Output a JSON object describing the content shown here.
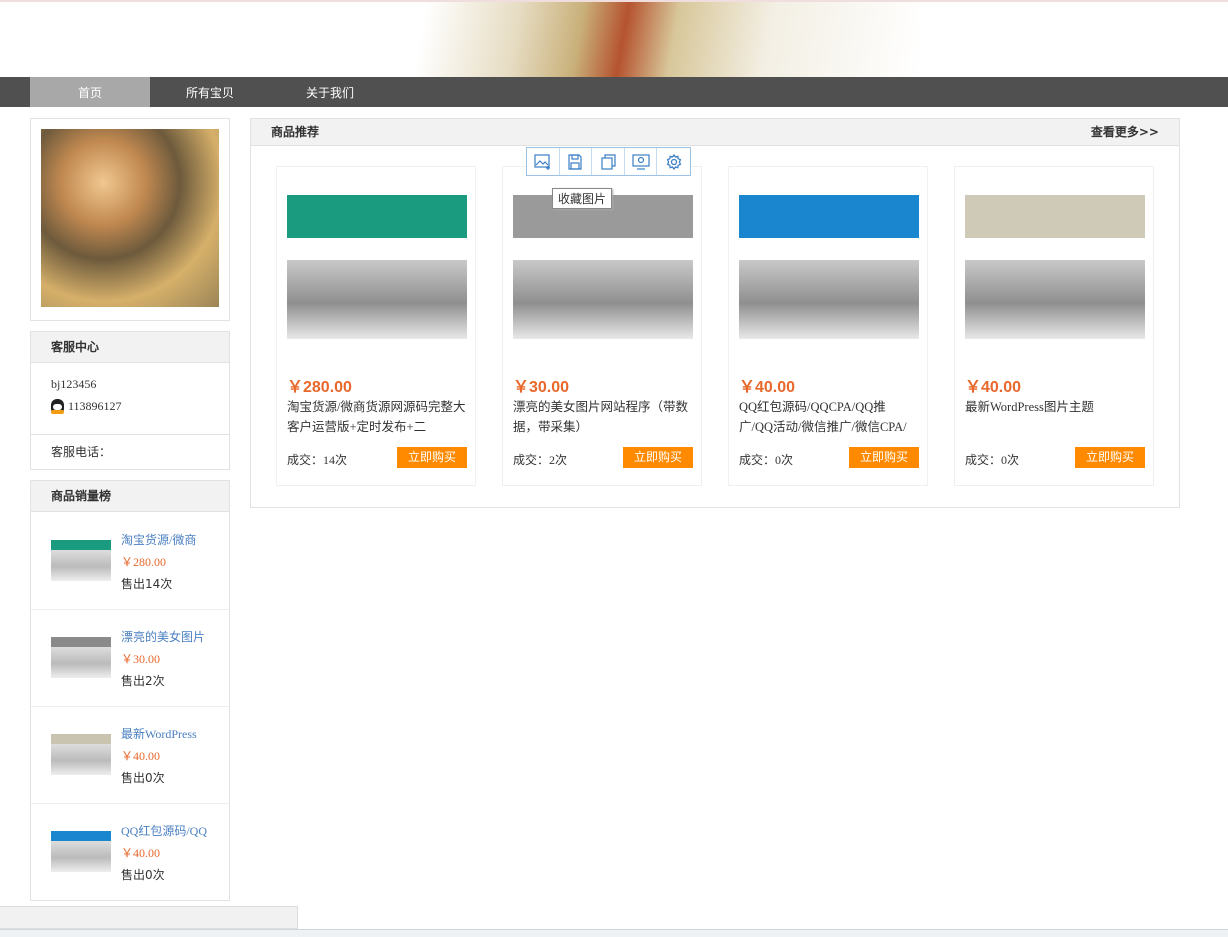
{
  "nav": {
    "items": [
      {
        "label": "首页",
        "active": true
      },
      {
        "label": "所有宝贝"
      },
      {
        "label": "关于我们"
      }
    ]
  },
  "service": {
    "title": "客服中心",
    "account": "bj123456",
    "qq": "113896127",
    "phone_label": "客服电话："
  },
  "ranking": {
    "title": "商品销量榜",
    "items": [
      {
        "title": "淘宝货源/微商",
        "price": "￥280.00",
        "sold": "售出14次",
        "thumb": "#1a9a7e"
      },
      {
        "title": "漂亮的美女图片",
        "price": "￥30.00",
        "sold": "售出2次",
        "thumb": "#8a8a8a"
      },
      {
        "title": "最新WordPress",
        "price": "￥40.00",
        "sold": "售出0次",
        "thumb": "#c8c4b0"
      },
      {
        "title": "QQ红包源码/QQ",
        "price": "￥40.00",
        "sold": "售出0次",
        "thumb": "#1a86d0"
      }
    ]
  },
  "recommend": {
    "title": "商品推荐",
    "more": "查看更多>>",
    "buy_label": "立即购买",
    "products": [
      {
        "price": "￥280.00",
        "title": "淘宝货源/微商货源网源码完整大客户运营版+定时发布+二",
        "sold": "成交：14次",
        "thumb": "#1a9a7e"
      },
      {
        "price": "￥30.00",
        "title": "漂亮的美女图片网站程序（带数据，带采集）",
        "sold": "成交：2次",
        "thumb": "#9a9a9a"
      },
      {
        "price": "￥40.00",
        "title": "QQ红包源码/QQCPA/QQ推广/QQ活动/微信推广/微信CPA/微",
        "sold": "成交：0次",
        "thumb": "#1a86d0"
      },
      {
        "price": "￥40.00",
        "title": "最新WordPress图片主题",
        "sold": "成交：0次",
        "thumb": "#cfcab8"
      }
    ]
  },
  "image_toolbar": {
    "tooltip": "收藏图片",
    "icons": [
      "add-image-icon",
      "save-icon",
      "copy-icon",
      "screenshot-icon",
      "settings-icon"
    ]
  },
  "colors": {
    "nav": "#505050",
    "active_tab": "#a8a8a8",
    "price": "#e8682c",
    "buy": "#ff8a00",
    "link": "#4a7fc1"
  }
}
